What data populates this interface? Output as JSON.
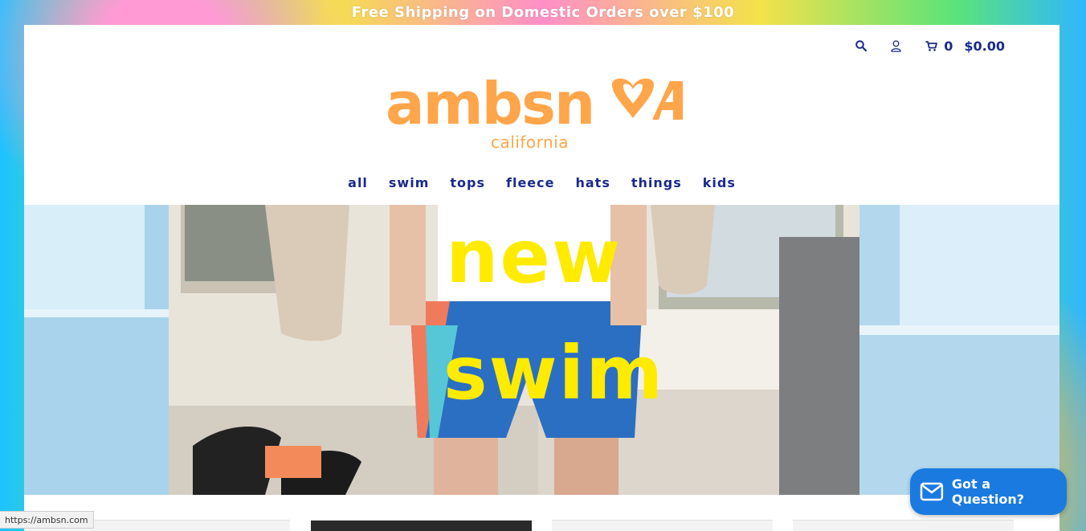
{
  "promo": {
    "text": "Free Shipping on Domestic Orders over $100"
  },
  "header": {
    "cart_count": "0",
    "cart_total": "$0.00"
  },
  "logo": {
    "wordmark": "ambsn",
    "subtitle": "california"
  },
  "nav": {
    "items": [
      {
        "label": "all"
      },
      {
        "label": "swim"
      },
      {
        "label": "tops"
      },
      {
        "label": "fleece"
      },
      {
        "label": "hats"
      },
      {
        "label": "things"
      },
      {
        "label": "kids"
      }
    ]
  },
  "hero": {
    "line1": "new",
    "line2": "swim"
  },
  "chat": {
    "label": "Got a Question?"
  },
  "status_bar": {
    "url": "https://ambsn.com"
  },
  "colors": {
    "brand_orange": "#ffa54a",
    "nav_blue": "#1a2b8c",
    "hero_yellow": "#ffeb00",
    "chat_blue": "#1a7ae0"
  }
}
